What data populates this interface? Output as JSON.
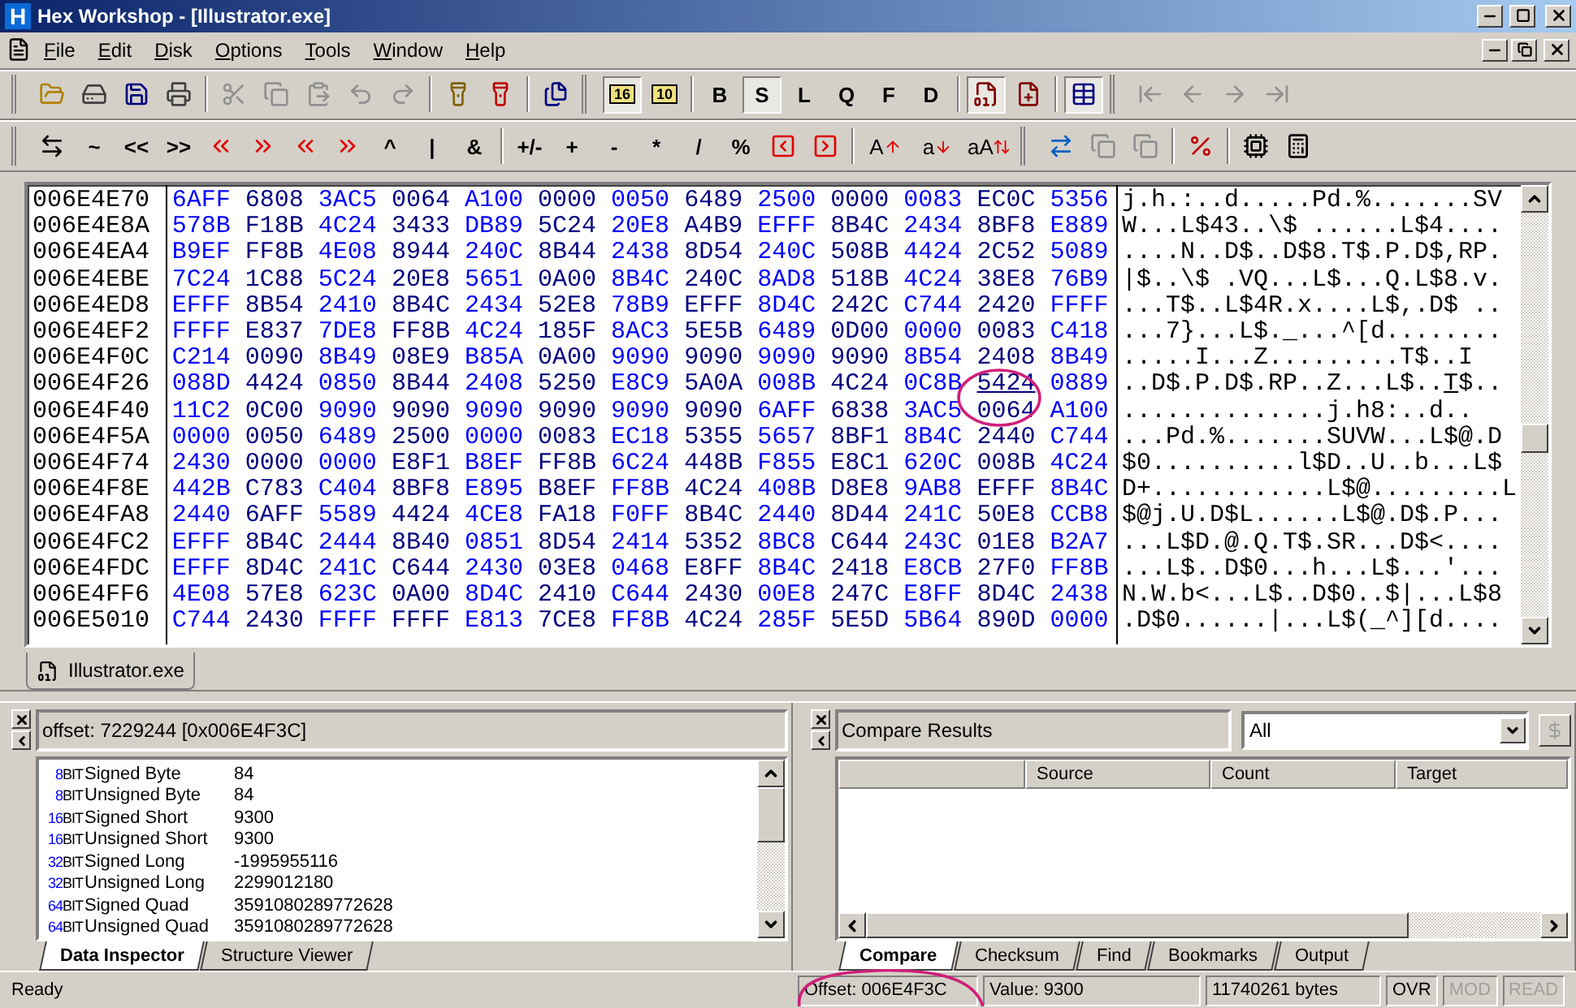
{
  "window": {
    "icon_letter": "H",
    "title": "Hex Workshop - [Illustrator.exe]"
  },
  "menu": [
    "File",
    "Edit",
    "Disk",
    "Options",
    "Tools",
    "Window",
    "Help"
  ],
  "toolbars": [
    {
      "items": [
        {
          "kind": "icon",
          "pressed": false,
          "disabled": false
        },
        {
          "kind": "icon",
          "pressed": false,
          "disabled": false
        },
        {
          "kind": "icon",
          "pressed": false,
          "disabled": false
        },
        {
          "kind": "icon",
          "pressed": false,
          "disabled": false
        },
        {
          "kind": "sep"
        },
        {
          "kind": "icon",
          "pressed": false,
          "disabled": true
        },
        {
          "kind": "icon",
          "pressed": false,
          "disabled": true
        },
        {
          "kind": "icon",
          "pressed": false,
          "disabled": true
        },
        {
          "kind": "icon",
          "pressed": false,
          "disabled": true
        },
        {
          "kind": "icon",
          "pressed": false,
          "disabled": true
        },
        {
          "kind": "sep"
        },
        {
          "kind": "icon",
          "pressed": false,
          "disabled": false
        },
        {
          "kind": "icon",
          "pressed": false,
          "disabled": false
        },
        {
          "kind": "sep"
        },
        {
          "kind": "icon",
          "pressed": false,
          "disabled": false
        },
        {
          "kind": "grip"
        },
        {
          "kind": "number",
          "label": "16",
          "pressed": true,
          "disabled": false
        },
        {
          "kind": "number",
          "label": "10",
          "pressed": false,
          "disabled": false
        },
        {
          "kind": "sep"
        },
        {
          "kind": "text",
          "label": "B",
          "pressed": false,
          "disabled": false
        },
        {
          "kind": "text",
          "label": "S",
          "pressed": true,
          "disabled": false
        },
        {
          "kind": "text",
          "label": "L",
          "pressed": false,
          "disabled": false
        },
        {
          "kind": "text",
          "label": "Q",
          "pressed": false,
          "disabled": false
        },
        {
          "kind": "text",
          "label": "F",
          "pressed": false,
          "disabled": false
        },
        {
          "kind": "text",
          "label": "D",
          "pressed": false,
          "disabled": false
        },
        {
          "kind": "sep"
        },
        {
          "kind": "icon",
          "pressed": true,
          "disabled": false
        },
        {
          "kind": "icon",
          "pressed": false,
          "disabled": false
        },
        {
          "kind": "sep"
        },
        {
          "kind": "icon",
          "pressed": true,
          "disabled": false
        },
        {
          "kind": "grip"
        },
        {
          "kind": "icon",
          "pressed": false,
          "disabled": true
        },
        {
          "kind": "icon",
          "pressed": false,
          "disabled": true
        },
        {
          "kind": "icon",
          "pressed": false,
          "disabled": true
        },
        {
          "kind": "icon",
          "pressed": false,
          "disabled": true
        }
      ]
    },
    {
      "items": [
        {
          "kind": "icon",
          "pressed": false,
          "disabled": false
        },
        {
          "kind": "text",
          "label": "~",
          "pressed": false,
          "disabled": false
        },
        {
          "kind": "text",
          "label": "<<",
          "pressed": false,
          "disabled": false
        },
        {
          "kind": "text",
          "label": ">>",
          "pressed": false,
          "disabled": false
        },
        {
          "kind": "icon",
          "pressed": false,
          "disabled": false
        },
        {
          "kind": "icon",
          "pressed": false,
          "disabled": false
        },
        {
          "kind": "icon",
          "pressed": false,
          "disabled": false
        },
        {
          "kind": "icon",
          "pressed": false,
          "disabled": false
        },
        {
          "kind": "text",
          "label": "^",
          "pressed": false,
          "disabled": false
        },
        {
          "kind": "text",
          "label": "|",
          "pressed": false,
          "disabled": false
        },
        {
          "kind": "text",
          "label": "&",
          "pressed": false,
          "disabled": false
        },
        {
          "kind": "sep"
        },
        {
          "kind": "text",
          "label": "+/-",
          "pressed": false,
          "disabled": false
        },
        {
          "kind": "text",
          "label": "+",
          "pressed": false,
          "disabled": false
        },
        {
          "kind": "text",
          "label": "-",
          "pressed": false,
          "disabled": false
        },
        {
          "kind": "text",
          "label": "*",
          "pressed": false,
          "disabled": false
        },
        {
          "kind": "text",
          "label": "/",
          "pressed": false,
          "disabled": false
        },
        {
          "kind": "text",
          "label": "%",
          "pressed": false,
          "disabled": false
        },
        {
          "kind": "icon",
          "pressed": false,
          "disabled": false
        },
        {
          "kind": "icon",
          "pressed": false,
          "disabled": false
        },
        {
          "kind": "sep"
        },
        {
          "kind": "letter",
          "label": "A",
          "pressed": false,
          "disabled": false
        },
        {
          "kind": "letter",
          "label": "a",
          "pressed": false,
          "disabled": false
        },
        {
          "kind": "letter",
          "label": "aA",
          "pressed": false,
          "disabled": false
        },
        {
          "kind": "grip"
        },
        {
          "kind": "icon",
          "pressed": false,
          "disabled": false
        },
        {
          "kind": "icon",
          "pressed": false,
          "disabled": true
        },
        {
          "kind": "icon",
          "pressed": false,
          "disabled": true
        },
        {
          "kind": "sep"
        },
        {
          "kind": "icon",
          "pressed": false,
          "disabled": false
        },
        {
          "kind": "sep"
        },
        {
          "kind": "icon",
          "pressed": false,
          "disabled": false
        },
        {
          "kind": "icon",
          "pressed": false,
          "disabled": false
        }
      ]
    }
  ],
  "hex_view": {
    "rows": [
      {
        "offset": "006E4E70",
        "words": [
          "6AFF",
          "6808",
          "3AC5",
          "0064",
          "A100",
          "0000",
          "0050",
          "6489",
          "2500",
          "0000",
          "0083",
          "EC0C",
          "5356"
        ],
        "text": "j.h.:..d.....Pd.%.......SV"
      },
      {
        "offset": "006E4E8A",
        "words": [
          "578B",
          "F18B",
          "4C24",
          "3433",
          "DB89",
          "5C24",
          "20E8",
          "A4B9",
          "EFFF",
          "8B4C",
          "2434",
          "8BF8",
          "E889"
        ],
        "text": "W...L$43..\\$ ......L$4...."
      },
      {
        "offset": "006E4EA4",
        "words": [
          "B9EF",
          "FF8B",
          "4E08",
          "8944",
          "240C",
          "8B44",
          "2438",
          "8D54",
          "240C",
          "508B",
          "4424",
          "2C52",
          "5089"
        ],
        "text": "....N..D$..D$8.T$.P.D$,RP."
      },
      {
        "offset": "006E4EBE",
        "words": [
          "7C24",
          "1C88",
          "5C24",
          "20E8",
          "5651",
          "0A00",
          "8B4C",
          "240C",
          "8AD8",
          "518B",
          "4C24",
          "38E8",
          "76B9"
        ],
        "text": "|$..\\$ .VQ...L$...Q.L$8.v."
      },
      {
        "offset": "006E4ED8",
        "words": [
          "EFFF",
          "8B54",
          "2410",
          "8B4C",
          "2434",
          "52E8",
          "78B9",
          "EFFF",
          "8D4C",
          "242C",
          "C744",
          "2420",
          "FFFF"
        ],
        "text": "...T$..L$4R.x....L$,.D$ .."
      },
      {
        "offset": "006E4EF2",
        "words": [
          "FFFF",
          "E837",
          "7DE8",
          "FF8B",
          "4C24",
          "185F",
          "8AC3",
          "5E5B",
          "6489",
          "0D00",
          "0000",
          "0083",
          "C418"
        ],
        "text": "...7}...L$._...^[d........"
      },
      {
        "offset": "006E4F0C",
        "words": [
          "C214",
          "0090",
          "8B49",
          "08E9",
          "B85A",
          "0A00",
          "9090",
          "9090",
          "9090",
          "9090",
          "8B54",
          "2408",
          "8B49"
        ],
        "text": ".....I...Z.........T$..I"
      },
      {
        "offset": "006E4F26",
        "words": [
          "088D",
          "4424",
          "0850",
          "8B44",
          "2408",
          "5250",
          "E8C9",
          "5A0A",
          "008B",
          "4C24",
          "0C8B"
        ],
        "cursor_word": "5424",
        "words_after": [
          "0889"
        ],
        "text": "..D$.P.D$.RP..Z...L$..",
        "cursor_char": "T",
        "text_after": "$.."
      },
      {
        "offset": "006E4F40",
        "words": [
          "11C2",
          "0C00",
          "9090",
          "9090",
          "9090",
          "9090",
          "9090",
          "9090",
          "6AFF",
          "6838",
          "3AC5",
          "0064",
          "A100"
        ],
        "text": "..............j.h8:..d.."
      },
      {
        "offset": "006E4F5A",
        "words": [
          "0000",
          "0050",
          "6489",
          "2500",
          "0000",
          "0083",
          "EC18",
          "5355",
          "5657",
          "8BF1",
          "8B4C",
          "2440",
          "C744"
        ],
        "text": "...Pd.%.......SUVW...L$@.D"
      },
      {
        "offset": "006E4F74",
        "words": [
          "2430",
          "0000",
          "0000",
          "E8F1",
          "B8EF",
          "FF8B",
          "6C24",
          "448B",
          "F855",
          "E8C1",
          "620C",
          "008B",
          "4C24"
        ],
        "text": "$0..........l$D..U..b...L$"
      },
      {
        "offset": "006E4F8E",
        "words": [
          "442B",
          "C783",
          "C404",
          "8BF8",
          "E895",
          "B8EF",
          "FF8B",
          "4C24",
          "408B",
          "D8E8",
          "9AB8",
          "EFFF",
          "8B4C"
        ],
        "text": "D+............L$@.........L"
      },
      {
        "offset": "006E4FA8",
        "words": [
          "2440",
          "6AFF",
          "5589",
          "4424",
          "4CE8",
          "FA18",
          "F0FF",
          "8B4C",
          "2440",
          "8D44",
          "241C",
          "50E8",
          "CCB8"
        ],
        "text": "$@j.U.D$L......L$@.D$.P..."
      },
      {
        "offset": "006E4FC2",
        "words": [
          "EFFF",
          "8B4C",
          "2444",
          "8B40",
          "0851",
          "8D54",
          "2414",
          "5352",
          "8BC8",
          "C644",
          "243C",
          "01E8",
          "B2A7"
        ],
        "text": "...L$D.@.Q.T$.SR...D$<...."
      },
      {
        "offset": "006E4FDC",
        "words": [
          "EFFF",
          "8D4C",
          "241C",
          "C644",
          "2430",
          "03E8",
          "0468",
          "E8FF",
          "8B4C",
          "2418",
          "E8CB",
          "27F0",
          "FF8B"
        ],
        "text": "...L$..D$0...h...L$...'..."
      },
      {
        "offset": "006E4FF6",
        "words": [
          "4E08",
          "57E8",
          "623C",
          "0A00",
          "8D4C",
          "2410",
          "C644",
          "2430",
          "00E8",
          "247C",
          "E8FF",
          "8D4C",
          "2438"
        ],
        "text": "N.W.b<...L$..D$0..$|...L$8"
      },
      {
        "offset": "006E5010",
        "words": [
          "C744",
          "2430",
          "FFFF",
          "FFFF",
          "E813",
          "7CE8",
          "FF8B",
          "4C24",
          "285F",
          "5E5D",
          "5B64",
          "890D",
          "0000"
        ],
        "text": ".D$0......|...L$(_^][d...."
      }
    ]
  },
  "document_tabs": [
    {
      "label": "Illustrator.exe",
      "selected": true
    }
  ],
  "inspector": {
    "header": "offset: 7229244 [0x006E4F3C]",
    "rows": [
      {
        "size": "8",
        "unit": "BIT",
        "name": "Signed Byte",
        "value": "84"
      },
      {
        "size": "8",
        "unit": "BIT",
        "name": "Unsigned Byte",
        "value": "84"
      },
      {
        "size": "16",
        "unit": "BIT",
        "name": "Signed Short",
        "value": "9300"
      },
      {
        "size": "16",
        "unit": "BIT",
        "name": "Unsigned Short",
        "value": "9300"
      },
      {
        "size": "32",
        "unit": "BIT",
        "name": "Signed Long",
        "value": "-1995955116"
      },
      {
        "size": "32",
        "unit": "BIT",
        "name": "Unsigned Long",
        "value": "2299012180"
      },
      {
        "size": "64",
        "unit": "BIT",
        "name": "Signed Quad",
        "value": "3591080289772628"
      },
      {
        "size": "64",
        "unit": "BIT",
        "name": "Unsigned Quad",
        "value": "3591080289772628"
      }
    ],
    "tabs": [
      {
        "label": "Data Inspector",
        "selected": true
      },
      {
        "label": "Structure Viewer",
        "selected": false
      }
    ]
  },
  "compare": {
    "header": "Compare Results",
    "filter": "All",
    "columns": [
      "Source",
      "Count",
      "Target"
    ],
    "tabs": [
      {
        "label": "Compare",
        "selected": true
      },
      {
        "label": "Checksum",
        "selected": false
      },
      {
        "label": "Find",
        "selected": false
      },
      {
        "label": "Bookmarks",
        "selected": false
      },
      {
        "label": "Output",
        "selected": false
      }
    ]
  },
  "status_bar": {
    "message": "Ready",
    "offset": "Offset: 006E4F3C",
    "value": "Value: 9300",
    "size": "11740261 bytes",
    "indicators": [
      {
        "label": "OVR",
        "disabled": false
      },
      {
        "label": "MOD",
        "disabled": true
      },
      {
        "label": "READ",
        "disabled": true
      }
    ]
  }
}
